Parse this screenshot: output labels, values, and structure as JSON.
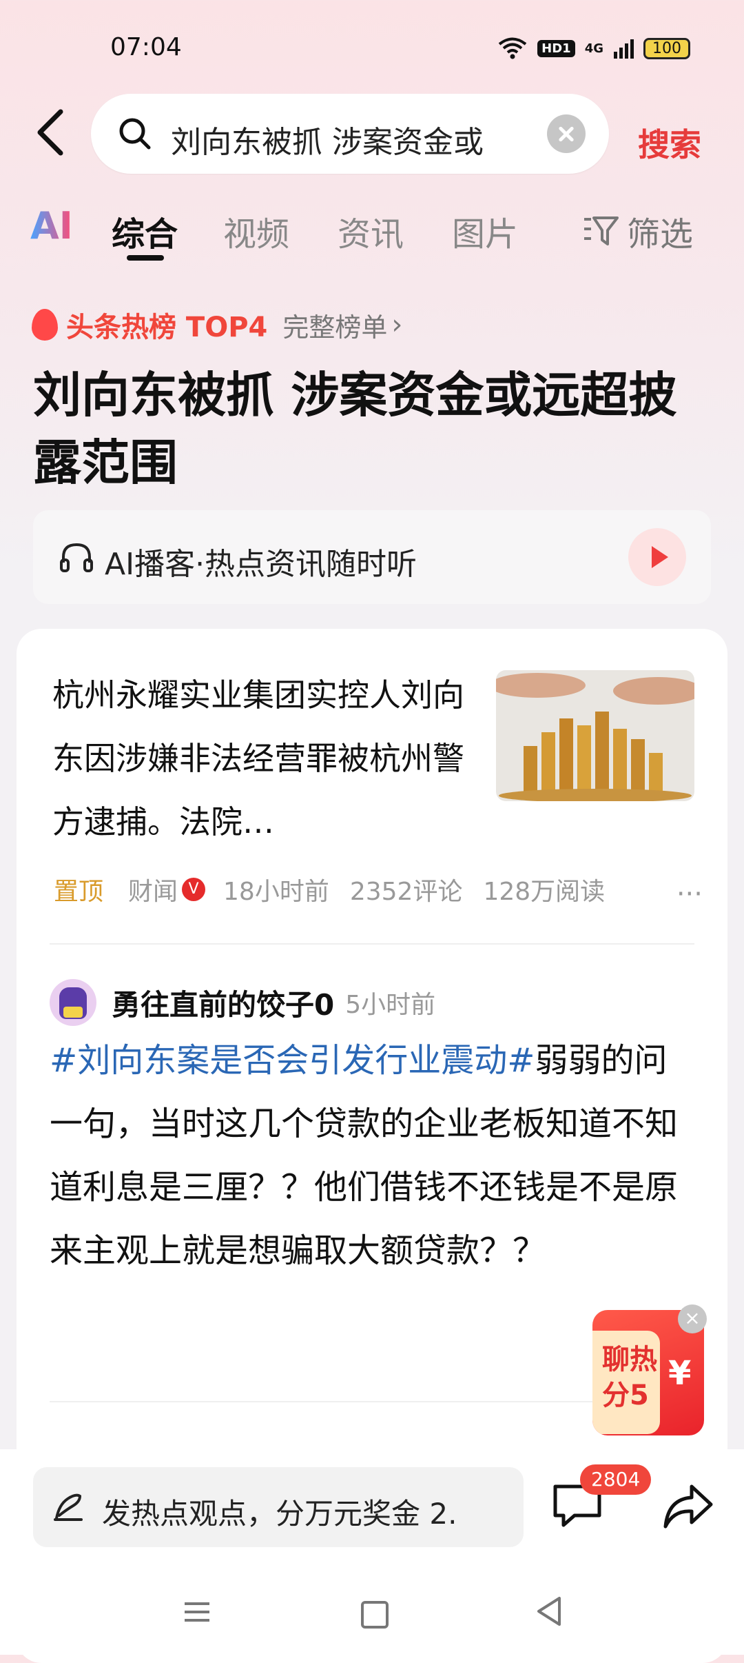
{
  "status": {
    "time": "07:04",
    "hd": "HD1",
    "network": "4G",
    "battery": "100"
  },
  "search": {
    "query": "刘向东被抓 涉案资金或",
    "button": "搜索"
  },
  "tabs": {
    "ai": "AI",
    "items": [
      "综合",
      "视频",
      "资讯",
      "图片"
    ],
    "active": 0,
    "filter": "筛选"
  },
  "hot": {
    "label": "头条热榜 TOP4",
    "full_list": "完整榜单"
  },
  "headline": "刘向东被抓 涉案资金或远超披露范围",
  "podcast": {
    "text": "AI播客·热点资讯随时听"
  },
  "article": {
    "text": "杭州永耀实业集团实控人刘向东因涉嫌非法经营罪被杭州警方逮捕。法院…",
    "pinned": "置顶",
    "source": "财闻",
    "verified": "V",
    "time": "18小时前",
    "comments": "2352评论",
    "reads": "128万阅读"
  },
  "post": {
    "author": "勇往直前的饺子0",
    "time": "5小时前",
    "hashtag": "#刘向东案是否会引发行业震动#",
    "body": "弱弱的问一句，当时这几个贷款的企业老板知道不知道利息是三厘？？他们借钱不还钱是不是原来主观上就是想骗取大额贷款？？"
  },
  "reward": {
    "line1": "聊热",
    "line2": "分5",
    "yen": "¥",
    "close": "×"
  },
  "bottom": {
    "comment_placeholder": "发热点观点，分万元奖金 2.",
    "comment_count": "2804"
  }
}
